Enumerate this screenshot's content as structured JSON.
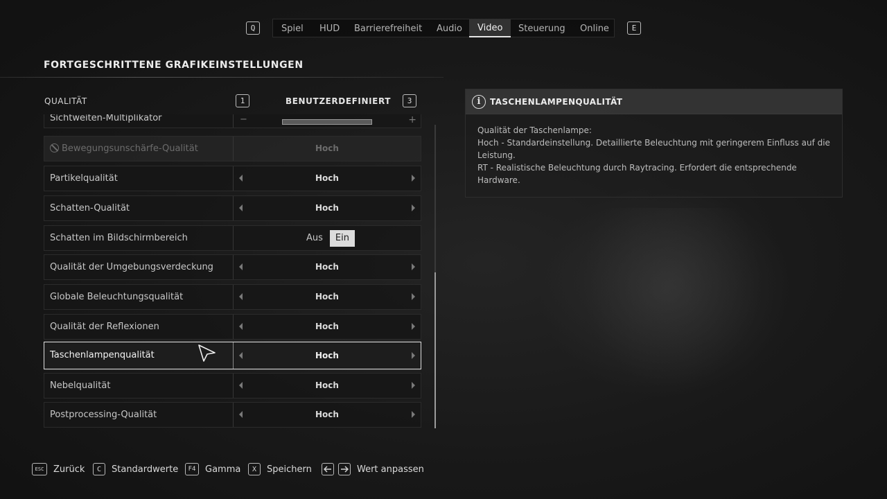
{
  "nav": {
    "prev_key": "Q",
    "next_key": "E",
    "tabs": [
      {
        "label": "Spiel"
      },
      {
        "label": "HUD"
      },
      {
        "label": "Barrierefreiheit"
      },
      {
        "label": "Audio"
      },
      {
        "label": "Video",
        "active": true
      },
      {
        "label": "Steuerung"
      },
      {
        "label": "Online"
      }
    ]
  },
  "section_title": "FORTGESCHRITTENE GRAFIKEINSTELLUNGEN",
  "preset": {
    "label": "QUALITÄT",
    "prev_key": "1",
    "value": "BENUTZERDEFINIERT",
    "next_key": "3"
  },
  "settings": [
    {
      "label": "Sichtweiten-Multiplikator",
      "type": "slider",
      "minus": "−",
      "plus": "+"
    },
    {
      "label": "Bewegungsunschärfe-Qualität",
      "value": "Hoch",
      "disabled": true
    },
    {
      "label": "Partikelqualität",
      "value": "Hoch"
    },
    {
      "label": "Schatten-Qualität",
      "value": "Hoch"
    },
    {
      "label": "Schatten im Bildschirmbereich",
      "type": "toggle",
      "off": "Aus",
      "on": "Ein"
    },
    {
      "label": "Qualität der Umgebungsverdeckung",
      "value": "Hoch"
    },
    {
      "label": "Globale Beleuchtungsqualität",
      "value": "Hoch"
    },
    {
      "label": "Qualität der Reflexionen",
      "value": "Hoch"
    },
    {
      "label": "Taschenlampenqualität",
      "value": "Hoch",
      "selected": true
    },
    {
      "label": "Nebelqualität",
      "value": "Hoch"
    },
    {
      "label": "Postprocessing-Qualität",
      "value": "Hoch"
    }
  ],
  "info": {
    "icon": "i",
    "title": "TASCHENLAMPENQUALITÄT",
    "lines": [
      "Qualität der Taschenlampe:",
      "Hoch - Standardeinstellung. Detaillierte Beleuchtung mit geringerem Einfluss auf die Leistung.",
      "RT - Realistische Beleuchtung durch Raytracing. Erfordert die entsprechende Hardware."
    ]
  },
  "bottom_hints": [
    {
      "key": "ESC",
      "label": "Zurück"
    },
    {
      "key": "C",
      "label": "Standardwerte"
    },
    {
      "key": "F4",
      "label": "Gamma"
    },
    {
      "key": "X",
      "label": "Speichern"
    },
    {
      "key": "arrows",
      "label": "Wert anpassen"
    }
  ]
}
